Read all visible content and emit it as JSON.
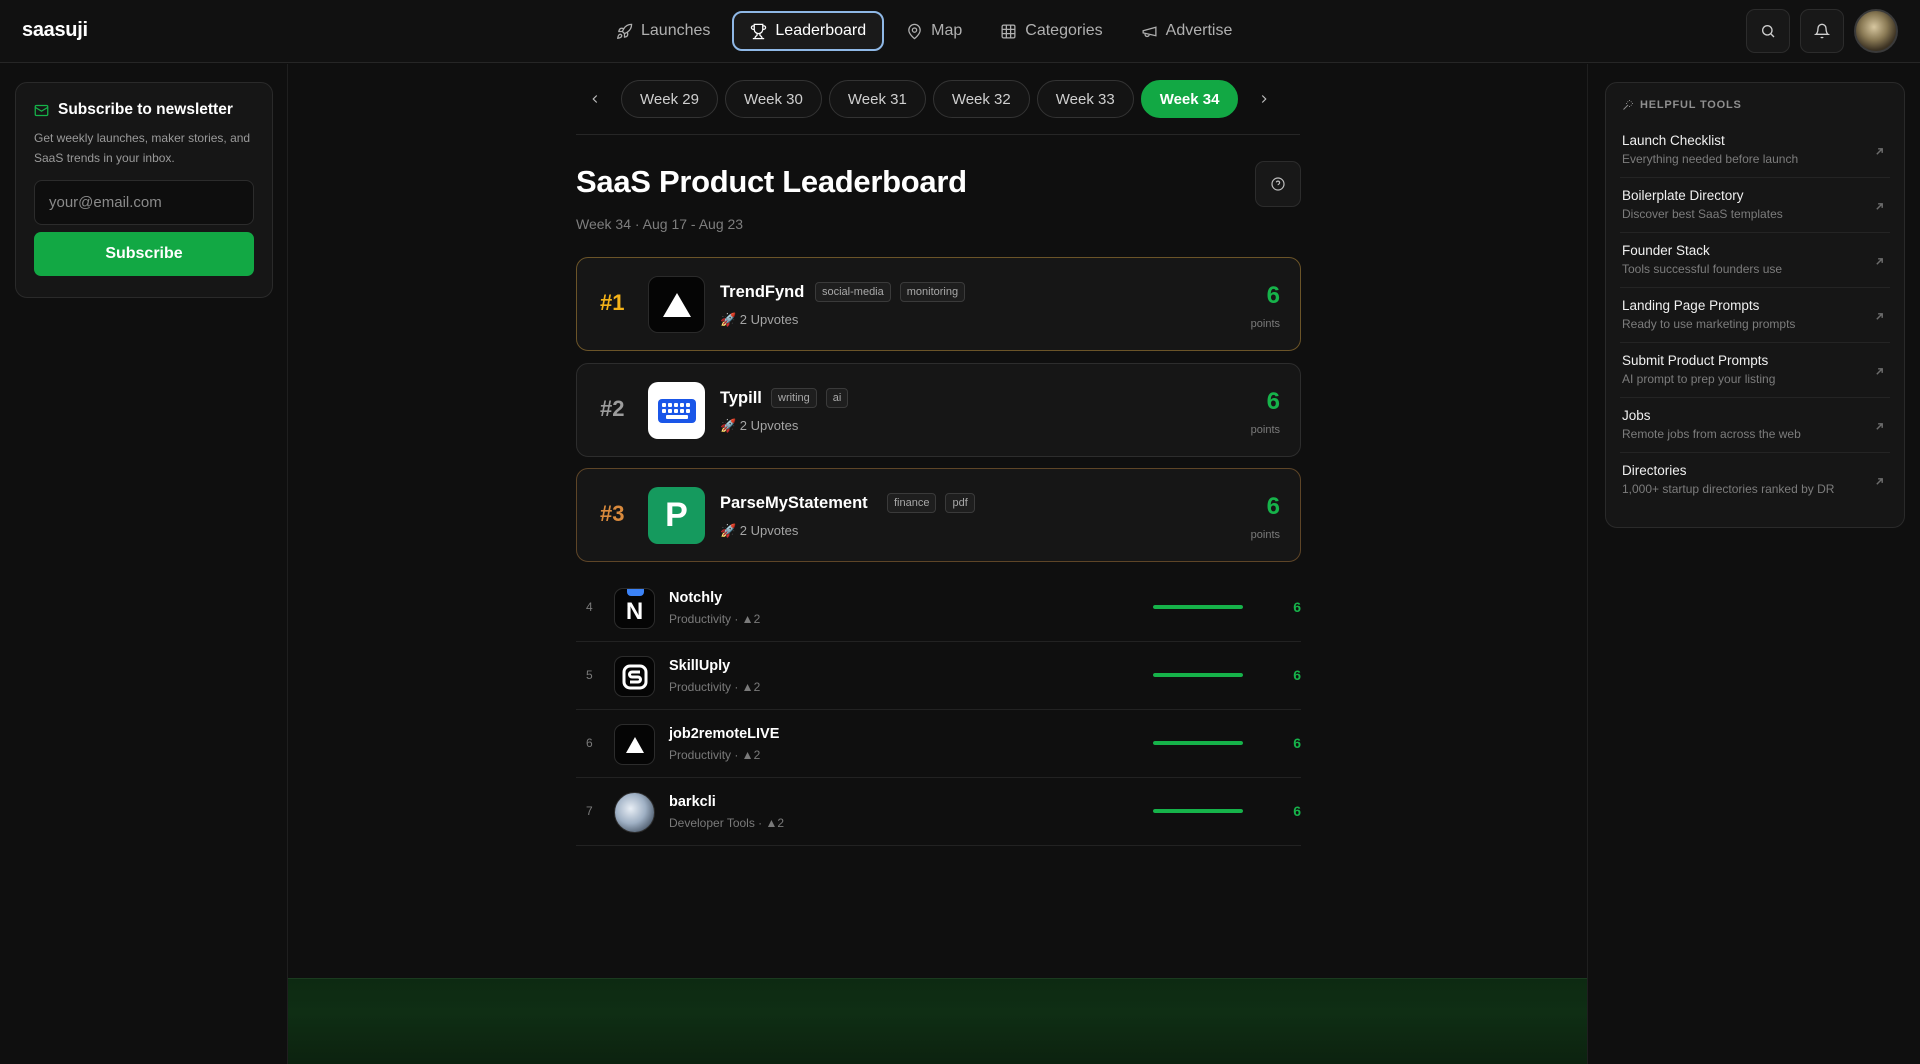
{
  "app": {
    "logo": "saasuji"
  },
  "nav": {
    "items": [
      {
        "label": "Launches",
        "icon": "rocket-icon",
        "active": false
      },
      {
        "label": "Leaderboard",
        "icon": "trophy-icon",
        "active": true
      },
      {
        "label": "Map",
        "icon": "map-pin-icon",
        "active": false
      },
      {
        "label": "Categories",
        "icon": "grid-icon",
        "active": false
      },
      {
        "label": "Advertise",
        "icon": "megaphone-icon",
        "active": false
      }
    ]
  },
  "newsletter": {
    "title": "Subscribe to newsletter",
    "description": "Get weekly launches, maker stories, and SaaS trends in your inbox.",
    "email_placeholder": "your@email.com",
    "button_label": "Subscribe"
  },
  "weeks": {
    "tabs": [
      "Week 29",
      "Week 30",
      "Week 31",
      "Week 32",
      "Week 33",
      "Week 34"
    ],
    "active": "Week 34"
  },
  "page": {
    "title": "SaaS Product Leaderboard",
    "subtitle": "Week 34 · Aug 17 - Aug 23"
  },
  "top_products": [
    {
      "rank": "#1",
      "name": "TrendFynd",
      "tags": [
        "social-media",
        "monitoring"
      ],
      "upvotes": "🚀 2 Upvotes",
      "points": "6",
      "points_label": "points"
    },
    {
      "rank": "#2",
      "name": "Typill",
      "tags": [
        "writing",
        "ai"
      ],
      "upvotes": "🚀 2 Upvotes",
      "points": "6",
      "points_label": "points"
    },
    {
      "rank": "#3",
      "name": "ParseMyStatement",
      "tags": [
        "finance",
        "pdf"
      ],
      "upvotes": "🚀 2 Upvotes",
      "points": "6",
      "points_label": "points",
      "logo_letter": "P"
    }
  ],
  "list_products": [
    {
      "rank": "4",
      "name": "Notchly",
      "meta": "Productivity · ▲2",
      "points": "6",
      "logo_letter": "N",
      "bar_fraction": 1.0
    },
    {
      "rank": "5",
      "name": "SkillUply",
      "meta": "Productivity · ▲2",
      "points": "6",
      "bar_fraction": 1.0
    },
    {
      "rank": "6",
      "name": "job2remoteLIVE",
      "meta": "Productivity · ▲2",
      "points": "6",
      "bar_fraction": 1.0
    },
    {
      "rank": "7",
      "name": "barkcli",
      "meta": "Developer Tools · ▲2",
      "points": "6",
      "bar_fraction": 1.0
    }
  ],
  "tools": {
    "title": "HELPFUL TOOLS",
    "items": [
      {
        "name": "Launch Checklist",
        "desc": "Everything needed before launch"
      },
      {
        "name": "Boilerplate Directory",
        "desc": "Discover best SaaS templates"
      },
      {
        "name": "Founder Stack",
        "desc": "Tools successful founders use"
      },
      {
        "name": "Landing Page Prompts",
        "desc": "Ready to use marketing prompts"
      },
      {
        "name": "Submit Product Prompts",
        "desc": "AI prompt to prep your listing"
      },
      {
        "name": "Jobs",
        "desc": "Remote jobs from across the web"
      },
      {
        "name": "Directories",
        "desc": "1,000+ startup directories ranked by DR"
      }
    ]
  },
  "colors": {
    "accent_green": "#12a844",
    "gold": "#f5b319",
    "bronze": "#d98a3d",
    "background": "#0f0f0f"
  }
}
